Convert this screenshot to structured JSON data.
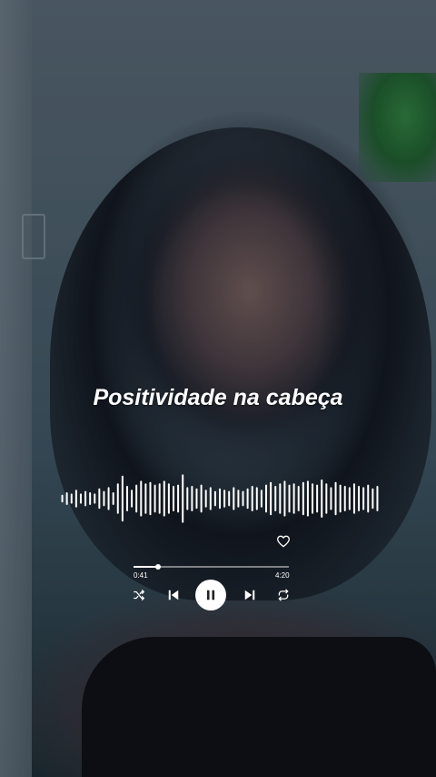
{
  "song": {
    "title": "Positividade na cabeça"
  },
  "player": {
    "current_time": "0:41",
    "total_time": "4:20",
    "progress_fraction": 0.16,
    "state": "playing",
    "liked": false
  },
  "icons": {
    "like": "heart-outline-icon",
    "shuffle": "shuffle-icon",
    "previous": "skip-previous-icon",
    "pause": "pause-icon",
    "next": "skip-next-icon",
    "repeat": "repeat-icon"
  },
  "waveform": {
    "levels": [
      0.15,
      0.25,
      0.2,
      0.35,
      0.2,
      0.3,
      0.25,
      0.2,
      0.4,
      0.3,
      0.45,
      0.25,
      0.6,
      0.9,
      0.5,
      0.35,
      0.55,
      0.7,
      0.6,
      0.65,
      0.55,
      0.6,
      0.7,
      0.6,
      0.5,
      0.55,
      0.95,
      0.45,
      0.5,
      0.4,
      0.55,
      0.35,
      0.45,
      0.3,
      0.4,
      0.35,
      0.3,
      0.45,
      0.35,
      0.3,
      0.4,
      0.5,
      0.45,
      0.35,
      0.55,
      0.65,
      0.5,
      0.6,
      0.7,
      0.55,
      0.6,
      0.5,
      0.65,
      0.7,
      0.6,
      0.55,
      0.75,
      0.6,
      0.45,
      0.65,
      0.55,
      0.5,
      0.45,
      0.6,
      0.5,
      0.45,
      0.55,
      0.4,
      0.5
    ],
    "color": "#ffffff"
  }
}
